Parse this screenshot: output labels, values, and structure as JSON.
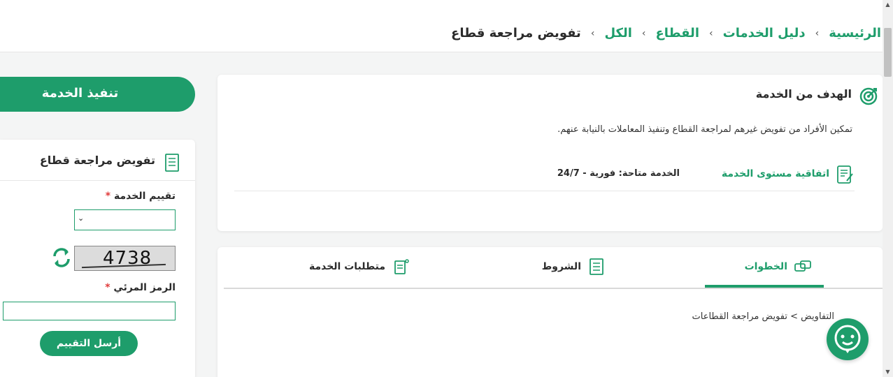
{
  "breadcrumb": {
    "items": [
      "الرئيسية",
      "دليل الخدمات",
      "القطاع",
      "الكل"
    ],
    "current": "تفويض مراجعة قطاع",
    "separator": "›"
  },
  "goal": {
    "title": "الهدف من الخدمة",
    "description": "تمكين الأفراد من تفويض غيرهم لمراجعة القطاع وتنفيذ المعاملات بالنيابة عنهم.",
    "sla_link": "اتفاقية مستوى الخدمة",
    "availability": "الخدمة متاحة: فورية - 24/7"
  },
  "tabs": {
    "steps": "الخطوات",
    "terms": "الشروط",
    "requirements": "متطلبات الخدمة",
    "content": "التفاويض > تفويض مراجعة القطاعات"
  },
  "sidebar": {
    "execute_button": "تنفيذ الخدمة",
    "rating_title": "تفويض مراجعة قطاع",
    "rating_label": "تقييم الخدمة",
    "required_mark": "*",
    "captcha_value": "4738",
    "captcha_label": "الرمز المرئي",
    "submit_button": "أرسل التقييم"
  },
  "colors": {
    "accent": "#1e9d6b",
    "required": "#e03b3b"
  }
}
